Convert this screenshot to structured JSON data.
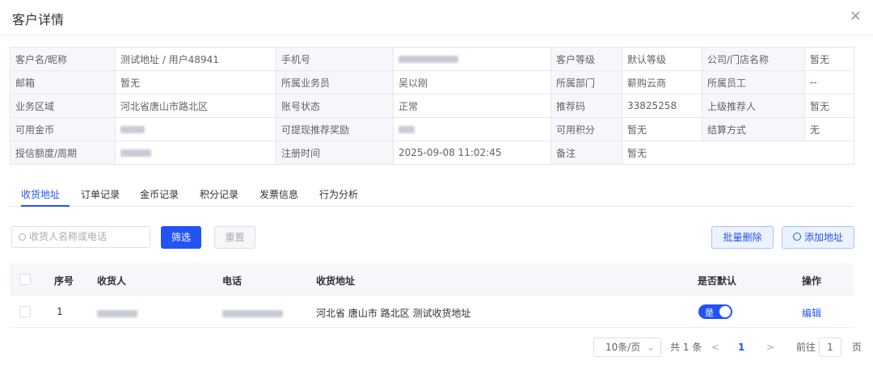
{
  "header": {
    "title": "客户详情",
    "close": "×"
  },
  "info": {
    "rows": [
      [
        {
          "label": "客户名/昵称",
          "value": "测试地址 / 用户48941"
        },
        {
          "label": "手机号",
          "value": "",
          "blurred": true
        },
        {
          "label": "客户等级",
          "value": "默认等级"
        },
        {
          "label": "公司/门店名称",
          "value": "暂无"
        }
      ],
      [
        {
          "label": "邮箱",
          "value": "暂无"
        },
        {
          "label": "所属业务员",
          "value": "吴以刚"
        },
        {
          "label": "所属部门",
          "value": "薪购云商"
        },
        {
          "label": "所属员工",
          "value": "--"
        }
      ],
      [
        {
          "label": "业务区域",
          "value": "河北省唐山市路北区"
        },
        {
          "label": "账号状态",
          "value": "正常"
        },
        {
          "label": "推荐码",
          "value": "33825258"
        },
        {
          "label": "上级推荐人",
          "value": "暂无"
        }
      ],
      [
        {
          "label": "可用金币",
          "value": "",
          "blurred": true
        },
        {
          "label": "可提现推荐奖励",
          "value": "",
          "blurred": true
        },
        {
          "label": "可用积分",
          "value": "暂无"
        },
        {
          "label": "结算方式",
          "value": "无"
        }
      ],
      [
        {
          "label": "授信额度/周期",
          "value": "",
          "blurred": true
        },
        {
          "label": "注册时间",
          "value": "2025-09-08 11:02:45"
        },
        {
          "label": "备注",
          "value": "暂无"
        }
      ]
    ]
  },
  "tabs": [
    "收货地址",
    "订单记录",
    "金币记录",
    "积分记录",
    "发票信息",
    "行为分析"
  ],
  "toolbar": {
    "search_placeholder": "收货人名称或电话",
    "filter": "筛选",
    "reset": "重置",
    "batch_delete": "批量删除",
    "add_address": "添加地址"
  },
  "table": {
    "columns": [
      "序号",
      "收货人",
      "电话",
      "收货地址",
      "是否默认",
      "操作"
    ],
    "rows": [
      {
        "index": "1",
        "address": "河北省 唐山市 路北区 测试收货地址",
        "default_label": "是",
        "default_on": true,
        "action": "编辑"
      }
    ]
  },
  "pagination": {
    "page_size": "10条/页",
    "total": "共 1 条",
    "prev": "<",
    "current": "1",
    "next": ">",
    "goto": "前往",
    "input": "1",
    "page": "页"
  },
  "colors": {
    "accent": "#2254f4"
  }
}
